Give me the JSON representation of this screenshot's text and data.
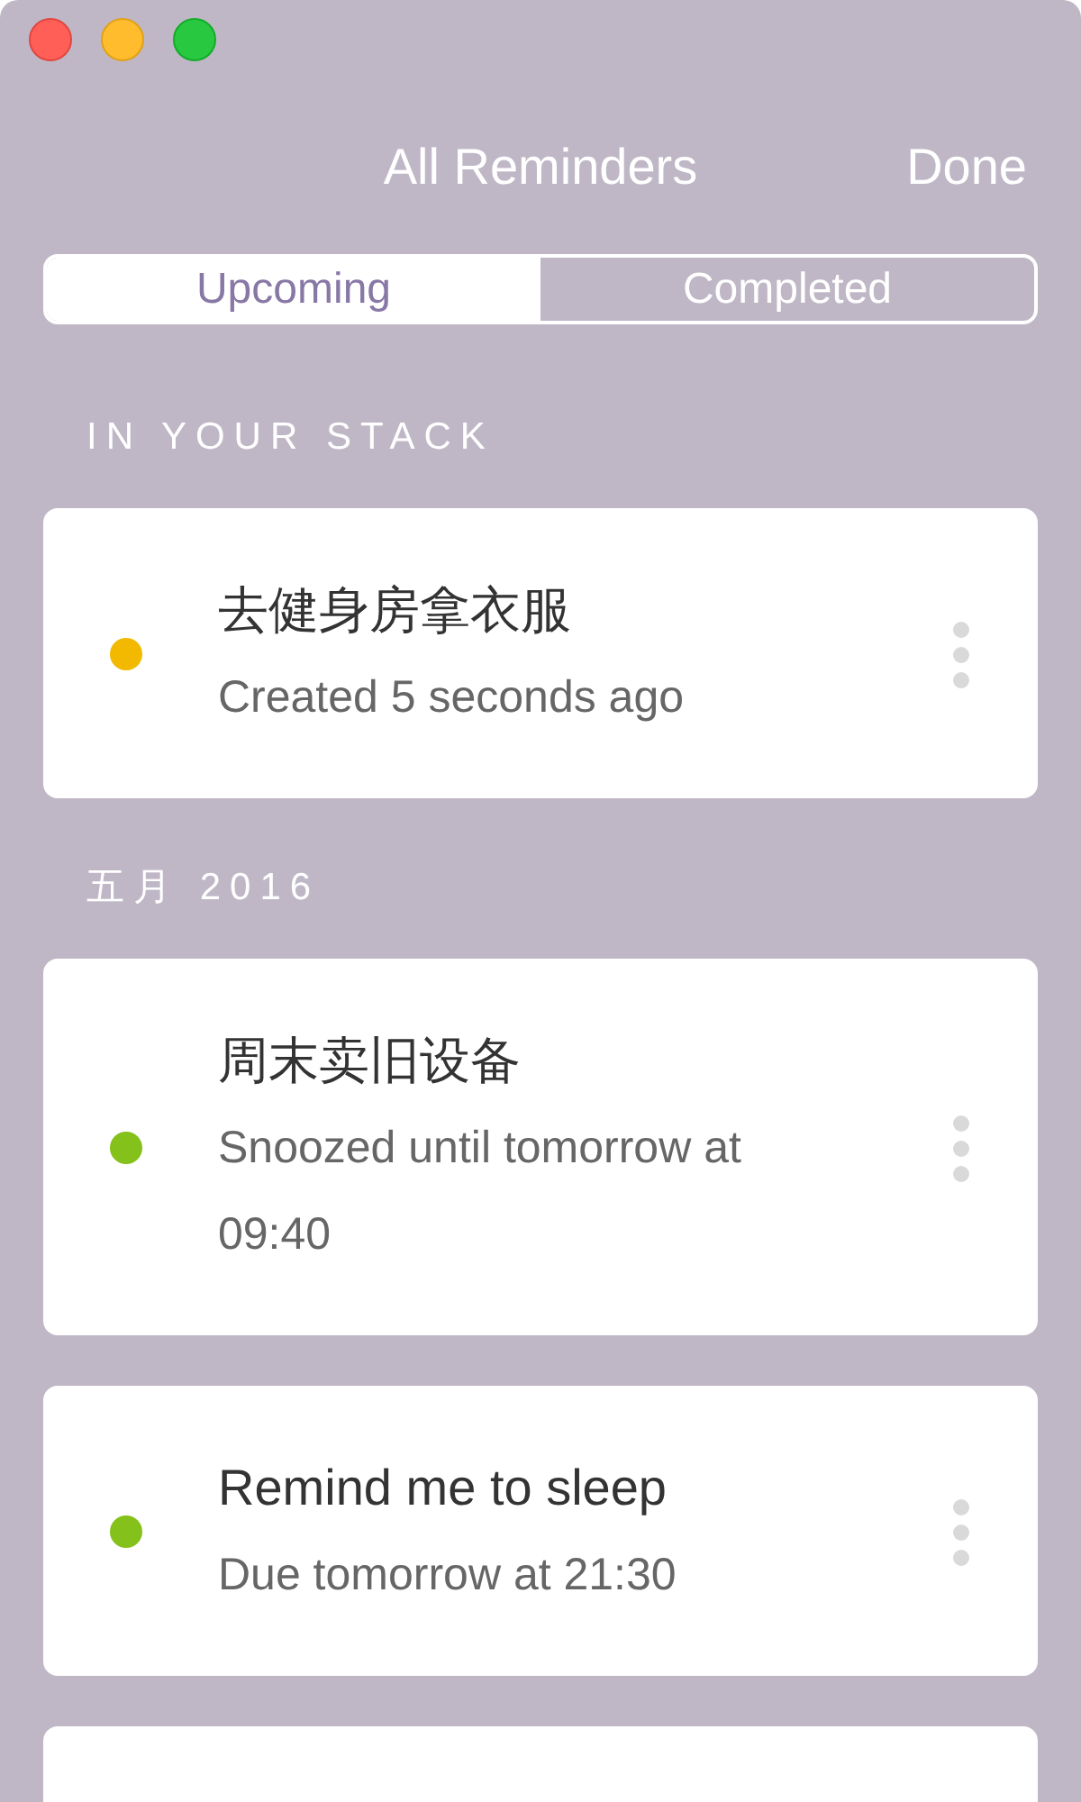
{
  "header": {
    "title": "All Reminders",
    "done_button": "Done"
  },
  "tabs": [
    {
      "label": "Upcoming",
      "selected": true
    },
    {
      "label": "Completed",
      "selected": false
    }
  ],
  "sections": [
    {
      "heading": "IN YOUR STACK",
      "reminders": [
        {
          "title": "去健身房拿衣服",
          "detail": "Created 5 seconds ago",
          "color": "#f2b900"
        }
      ]
    },
    {
      "heading": "五月 2016",
      "reminders": [
        {
          "title": "周末卖旧设备",
          "detail": "Snoozed until tomorrow at 09:40",
          "color": "#84c11a"
        },
        {
          "title": "Remind me to sleep",
          "detail": "Due tomorrow at 21:30",
          "color": "#84c11a"
        }
      ]
    }
  ]
}
